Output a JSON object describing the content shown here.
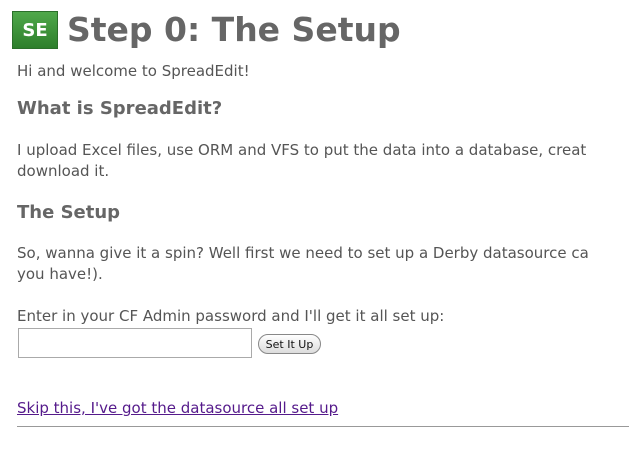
{
  "header": {
    "logo_text": "SE",
    "title": "Step 0: The Setup"
  },
  "intro": "Hi and welcome to SpreadEdit!",
  "what_section": {
    "heading": "What is SpreadEdit?",
    "line1": "I upload Excel files, use ORM and VFS to put the data into a database, creat",
    "line2": "download it."
  },
  "setup_section": {
    "heading": "The Setup",
    "line1": "So, wanna give it a spin? Well first we need to set up a Derby datasource ca",
    "line2": "you have!)."
  },
  "form": {
    "prompt": "Enter in your CF Admin password and I'll get it all set up:",
    "password_value": "",
    "button_label": "Set It Up"
  },
  "skip_link": "Skip this, I've got the datasource all set up",
  "colors": {
    "logo_green": "#3a8f36",
    "heading_gray": "#666666",
    "link_visited": "#551a8b"
  }
}
